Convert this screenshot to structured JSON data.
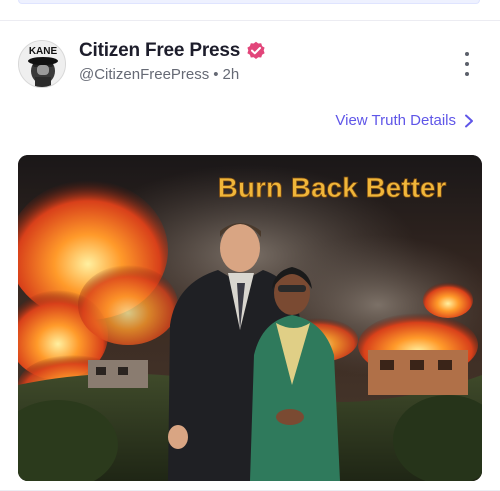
{
  "post": {
    "display_name": "Citizen Free Press",
    "handle": "@CitizenFreePress",
    "separator": "•",
    "time": "2h",
    "avatar_text": "KANE",
    "details_link": "View Truth Details"
  },
  "media": {
    "caption": "Burn Back Better"
  },
  "colors": {
    "accent": "#5f56e8",
    "verified": "#e2457a",
    "caption": "#f0b63a"
  },
  "icons": {
    "verified": "verified-badge-icon",
    "more": "more-vertical-icon",
    "chevron": "chevron-right-icon"
  }
}
